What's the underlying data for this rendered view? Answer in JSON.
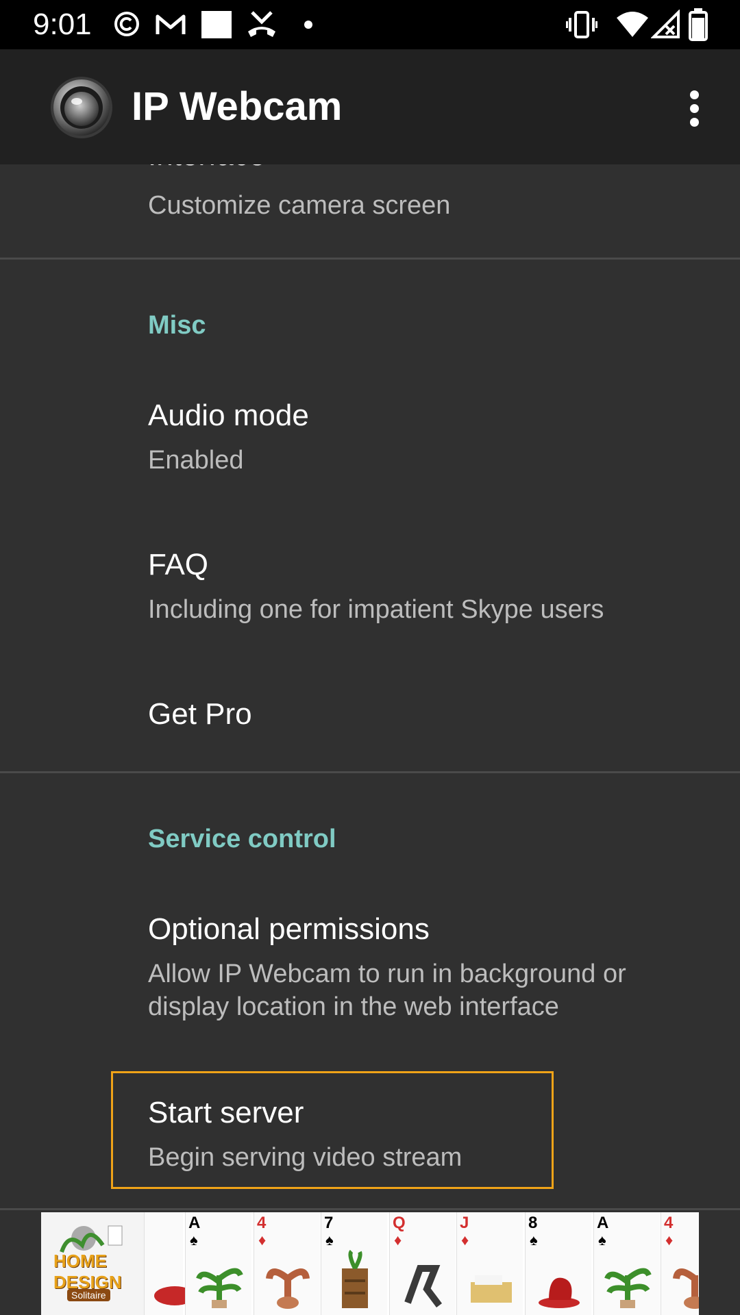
{
  "status_bar": {
    "time": "9:01"
  },
  "app_bar": {
    "title": "IP Webcam",
    "logo_icon": "webcam-lens-icon",
    "menu_icon": "more-vert-icon"
  },
  "preferences": {
    "interface": {
      "title": "Interface",
      "summary": "Customize camera screen"
    },
    "misc_category": "Misc",
    "audio_mode": {
      "title": "Audio mode",
      "summary": "Enabled"
    },
    "faq": {
      "title": "FAQ",
      "summary": "Including one for impatient Skype users"
    },
    "get_pro": {
      "title": "Get Pro"
    },
    "service_category": "Service control",
    "optional_permissions": {
      "title": "Optional permissions",
      "summary_line1": "Allow IP Webcam to run in background or",
      "summary_line2": "display location in the web interface"
    },
    "start_server": {
      "title": "Start server",
      "summary": "Begin serving video stream"
    }
  },
  "ad": {
    "logo_text": "HOME DESIGN",
    "logo_sub": "Solitaire",
    "cards": [
      {
        "rank": "",
        "suit": "",
        "color": "#d32f2f"
      },
      {
        "rank": "A",
        "suit": "♠",
        "color": "#000000"
      },
      {
        "rank": "4",
        "suit": "♦",
        "color": "#d32f2f"
      },
      {
        "rank": "7",
        "suit": "♠",
        "color": "#000000"
      },
      {
        "rank": "Q",
        "suit": "♦",
        "color": "#d32f2f"
      },
      {
        "rank": "J",
        "suit": "♦",
        "color": "#d32f2f"
      },
      {
        "rank": "8",
        "suit": "♠",
        "color": "#000000"
      },
      {
        "rank": "A",
        "suit": "♠",
        "color": "#000000"
      },
      {
        "rank": "4",
        "suit": "♦",
        "color": "#d32f2f"
      }
    ]
  },
  "colors": {
    "accent": "#80cbc4",
    "focus": "#f0a318",
    "background": "#303030",
    "app_bar": "#212121"
  }
}
